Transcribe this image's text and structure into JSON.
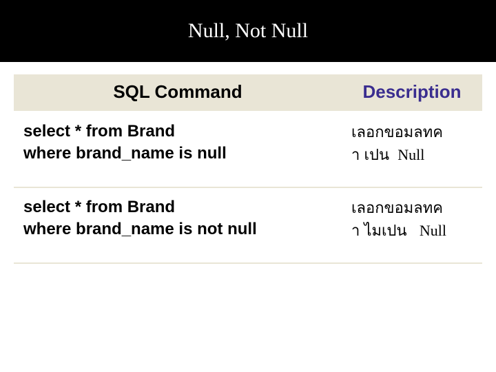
{
  "title": "Null, Not Null",
  "headers": {
    "command": "SQL Command",
    "description": "Description"
  },
  "rows": [
    {
      "command": "select * from Brand\nwhere brand_name is null",
      "description_th_a": "เลอกขอมลทค",
      "description_th_b": "า เปน",
      "description_tail": "Null"
    },
    {
      "command": "select * from Brand\nwhere brand_name is not null",
      "description_th_a": "เลอกขอมลทค",
      "description_th_b": "า ไมเปน",
      "description_tail": "Null"
    }
  ]
}
